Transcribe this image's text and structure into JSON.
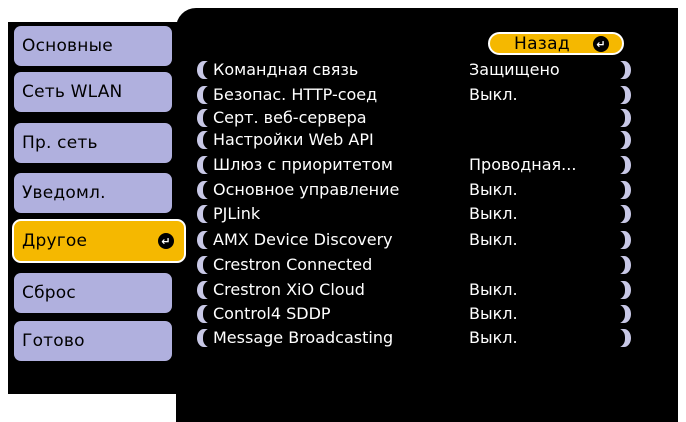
{
  "sidebar": {
    "items": [
      {
        "label": "Основные"
      },
      {
        "label": "Сеть WLAN"
      },
      {
        "label": "Пр. сеть"
      },
      {
        "label": "Уведомл."
      },
      {
        "label": "Другое",
        "selected": true
      },
      {
        "label": "Сброс"
      },
      {
        "label": "Готово"
      }
    ]
  },
  "main": {
    "back_label": "Назад",
    "rows": [
      {
        "label": "Командная связь",
        "value": "Защищено"
      },
      {
        "label": "Безопас. HTTP-соед",
        "value": "Выкл."
      },
      {
        "label": "Серт. веб-сервера",
        "value": ""
      },
      {
        "label": "Настройки Web API",
        "value": ""
      },
      {
        "label": "Шлюз с приоритетом",
        "value": "Проводная..."
      },
      {
        "label": "Основное управление",
        "value": "Выкл."
      },
      {
        "label": "PJLink",
        "value": "Выкл."
      },
      {
        "label": "AMX Device Discovery",
        "value": "Выкл."
      },
      {
        "label": "Crestron Connected",
        "value": ""
      },
      {
        "label": "Crestron XiO Cloud",
        "value": "Выкл."
      },
      {
        "label": "Control4 SDDP",
        "value": "Выкл."
      },
      {
        "label": "Message Broadcasting",
        "value": "Выкл."
      }
    ]
  },
  "colors": {
    "highlight": "#f5b800",
    "tab": "#b0b0de",
    "panel": "#000000"
  }
}
